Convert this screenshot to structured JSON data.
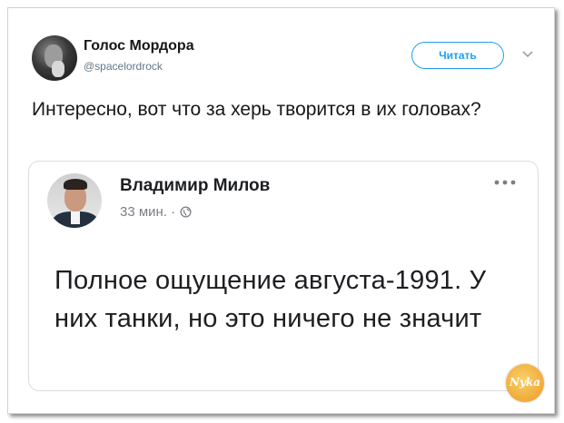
{
  "tweet": {
    "author_name": "Голос Мордора",
    "author_handle": "@spacelordrock",
    "follow_label": "Читать",
    "text": "Интересно, вот что за херь творится в их головах?"
  },
  "quoted_post": {
    "author_name": "Владимир Милов",
    "time": "33 мин. ·",
    "text": "Полное ощущение августа-1991. У них танки, но это ничего не значит"
  },
  "watermark": {
    "label": "Nyka"
  },
  "colors": {
    "twitter_blue": "#1da1f2",
    "text_dark": "#14171a",
    "muted": "#657786",
    "watermark_orange": "#f2a93a"
  },
  "icons": {
    "chevron": "chevron-down-icon",
    "globe": "globe-icon",
    "more": "more-icon"
  }
}
